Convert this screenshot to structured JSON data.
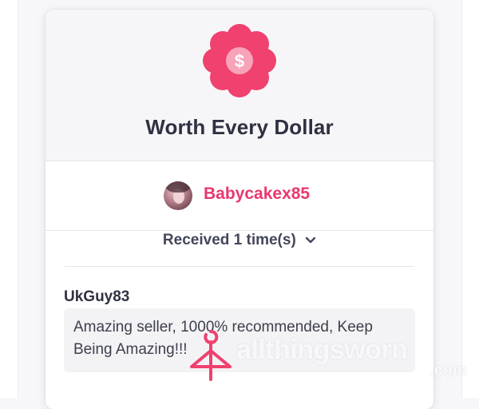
{
  "gift": {
    "icon": "dollar-badge-icon",
    "title": "Worth Every Dollar",
    "accent_color": "#f0416f"
  },
  "sender": {
    "avatar": "user-avatar",
    "username": "Babycakex85"
  },
  "received": {
    "label": "Received 1 time(s)",
    "toggle_icon": "chevron-down-icon"
  },
  "review": {
    "author": "UkGuy83",
    "text": "Amazing seller, 1000% recommended, Keep Being Amazing!!!"
  },
  "watermark": {
    "text": "allthingsworn",
    "suffix": ".com"
  }
}
